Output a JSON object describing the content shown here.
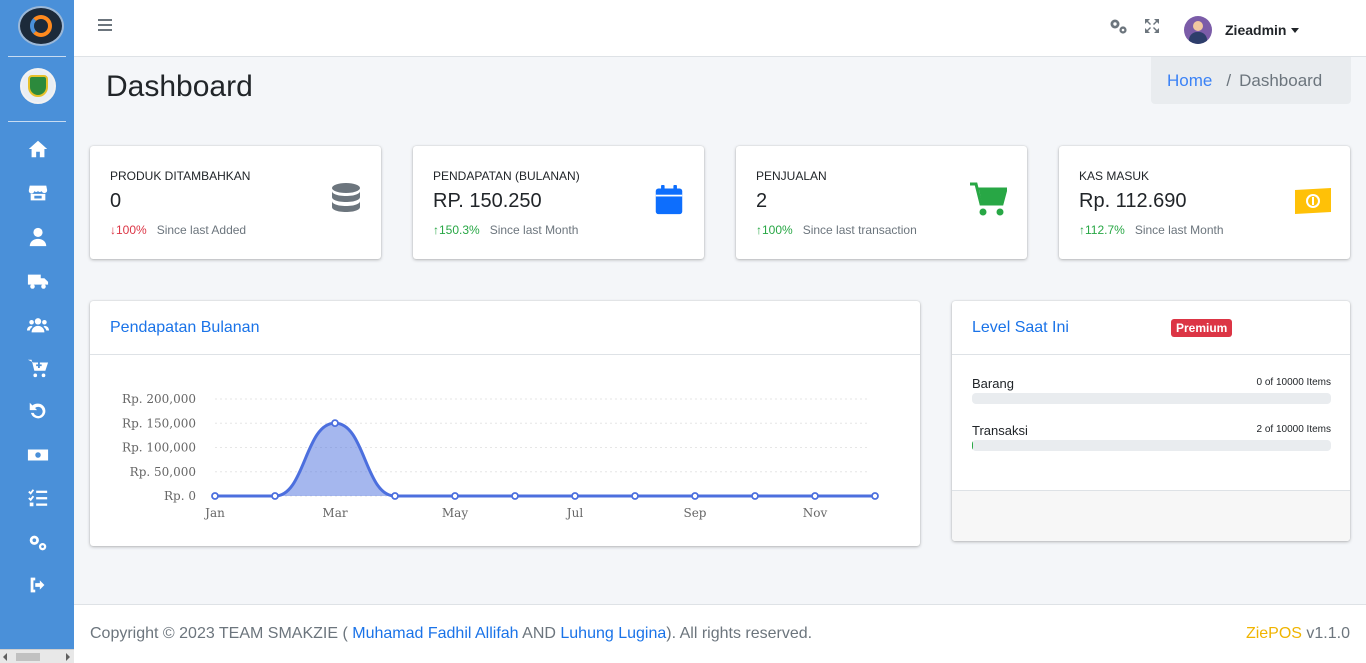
{
  "topbar": {
    "username": "Zieadmin"
  },
  "page": {
    "title": "Dashboard",
    "breadcrumb": {
      "home": "Home",
      "separator": "/",
      "current": "Dashboard"
    }
  },
  "stats": [
    {
      "label": "PRODUK DITAMBAHKAN",
      "value": "0",
      "arrow": "↓",
      "pct": "100%",
      "direction": "down",
      "since": "Since last Added",
      "icon": "database-icon",
      "icon_color": "#6c757d"
    },
    {
      "label": "PENDAPATAN (BULANAN)",
      "value": "RP. 150.250",
      "arrow": "↑",
      "pct": "150.3%",
      "direction": "up",
      "since": "Since last Month",
      "icon": "calendar-icon",
      "icon_color": "#0d6efd"
    },
    {
      "label": "PENJUALAN",
      "value": "2",
      "arrow": "↑",
      "pct": "100%",
      "direction": "up",
      "since": "Since last transaction",
      "icon": "cart-icon",
      "icon_color": "#28a745"
    },
    {
      "label": "KAS MASUK",
      "value": "Rp. 112.690",
      "arrow": "↑",
      "pct": "112.7%",
      "direction": "up",
      "since": "Since last Month",
      "icon": "money-icon",
      "icon_color": "#ffc107"
    }
  ],
  "chart_card": {
    "title": "Pendapatan Bulanan"
  },
  "chart_data": {
    "type": "area",
    "title": "Pendapatan Bulanan",
    "xlabel": "",
    "ylabel": "",
    "x": [
      "Jan",
      "Feb",
      "Mar",
      "Apr",
      "May",
      "Jun",
      "Jul",
      "Aug",
      "Sep",
      "Oct",
      "Nov",
      "Dec"
    ],
    "tick_labels_x": [
      "Jan",
      "Mar",
      "May",
      "Jul",
      "Sep",
      "Nov"
    ],
    "tick_labels_y": [
      "Rp. 200,000",
      "Rp. 150,000",
      "Rp. 100,000",
      "Rp. 50,000",
      "Rp. 0"
    ],
    "series": [
      {
        "values": [
          0,
          0,
          150250,
          0,
          0,
          0,
          0,
          0,
          0,
          0,
          0,
          0
        ],
        "color": "#4c6fde"
      }
    ],
    "ylim": [
      0,
      200000
    ],
    "grid": true
  },
  "level_card": {
    "title": "Level Saat Ini",
    "badge": "Premium",
    "rows": [
      {
        "name": "Barang",
        "count": "0 of 10000 Items",
        "fraction": 0.0
      },
      {
        "name": "Transaksi",
        "count": "2 of 10000 Items",
        "fraction": 0.0002
      }
    ]
  },
  "footer": {
    "copyright": "Copyright © 2023 TEAM SMAKZIE (",
    "author1": "Muhamad Fadhil Allifah",
    "and": "AND",
    "author2": "Luhung Lugina",
    "rights": "). All rights reserved.",
    "brand": "ZiePOS",
    "version": "v1.1.0"
  },
  "sidebar": {
    "items": [
      "home-icon",
      "store-icon",
      "user-icon",
      "truck-icon",
      "users-icon",
      "cart-plus-icon",
      "undo-icon",
      "money-icon",
      "tasks-icon",
      "gears-icon",
      "sign-out-icon"
    ]
  }
}
